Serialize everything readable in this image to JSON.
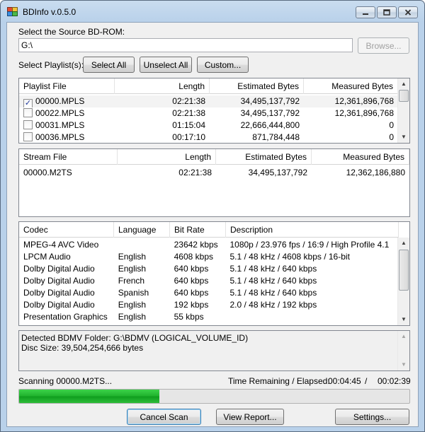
{
  "window": {
    "title": "BDInfo v.0.5.0"
  },
  "source": {
    "label": "Select the Source BD-ROM:",
    "path": "G:\\",
    "browse_label": "Browse..."
  },
  "playlist_controls": {
    "label": "Select Playlist(s):",
    "select_all": "Select All",
    "unselect_all": "Unselect All",
    "custom": "Custom..."
  },
  "playlists": {
    "columns": [
      "Playlist File",
      "Length",
      "Estimated Bytes",
      "Measured Bytes"
    ],
    "rows": [
      {
        "file": "00000.MPLS",
        "checked": true,
        "length": "02:21:38",
        "estimated": "34,495,137,792",
        "measured": "12,361,896,768"
      },
      {
        "file": "00022.MPLS",
        "checked": false,
        "length": "02:21:38",
        "estimated": "34,495,137,792",
        "measured": "12,361,896,768"
      },
      {
        "file": "00031.MPLS",
        "checked": false,
        "length": "01:15:04",
        "estimated": "22,666,444,800",
        "measured": "0"
      },
      {
        "file": "00036.MPLS",
        "checked": false,
        "length": "00:17:10",
        "estimated": "871,784,448",
        "measured": "0"
      }
    ]
  },
  "streams": {
    "columns": [
      "Stream File",
      "Length",
      "Estimated Bytes",
      "Measured Bytes"
    ],
    "rows": [
      {
        "file": "00000.M2TS",
        "length": "02:21:38",
        "estimated": "34,495,137,792",
        "measured": "12,362,186,880"
      }
    ]
  },
  "codecs": {
    "columns": [
      "Codec",
      "Language",
      "Bit Rate",
      "Description"
    ],
    "rows": [
      {
        "codec": "MPEG-4 AVC Video",
        "language": "",
        "bitrate": "23642 kbps",
        "description": "1080p / 23.976 fps / 16:9 / High Profile 4.1"
      },
      {
        "codec": "LPCM Audio",
        "language": "English",
        "bitrate": "4608 kbps",
        "description": "5.1 / 48 kHz / 4608 kbps / 16-bit"
      },
      {
        "codec": "Dolby Digital Audio",
        "language": "English",
        "bitrate": "640 kbps",
        "description": "5.1 / 48 kHz / 640 kbps"
      },
      {
        "codec": "Dolby Digital Audio",
        "language": "French",
        "bitrate": "640 kbps",
        "description": "5.1 / 48 kHz / 640 kbps"
      },
      {
        "codec": "Dolby Digital Audio",
        "language": "Spanish",
        "bitrate": "640 kbps",
        "description": "5.1 / 48 kHz / 640 kbps"
      },
      {
        "codec": "Dolby Digital Audio",
        "language": "English",
        "bitrate": "192 kbps",
        "description": "2.0 / 48 kHz / 192 kbps"
      },
      {
        "codec": "Presentation Graphics",
        "language": "English",
        "bitrate": "55 kbps",
        "description": ""
      }
    ]
  },
  "info": {
    "line1": "Detected BDMV Folder: G:\\BDMV (LOGICAL_VOLUME_ID)",
    "line2": "Disc Size: 39,504,254,666 bytes"
  },
  "scan": {
    "status": "Scanning 00000.M2TS...",
    "time_label": "Time Remaining / Elapsed:",
    "remaining": "00:04:45",
    "separator": "/",
    "elapsed": "00:02:39",
    "progress_fraction": 0.36
  },
  "buttons": {
    "cancel_scan": "Cancel Scan",
    "view_report": "View Report...",
    "settings": "Settings..."
  },
  "colors": {
    "progress_green": "#1fb12c",
    "title_bar": "#b9d1ea"
  }
}
